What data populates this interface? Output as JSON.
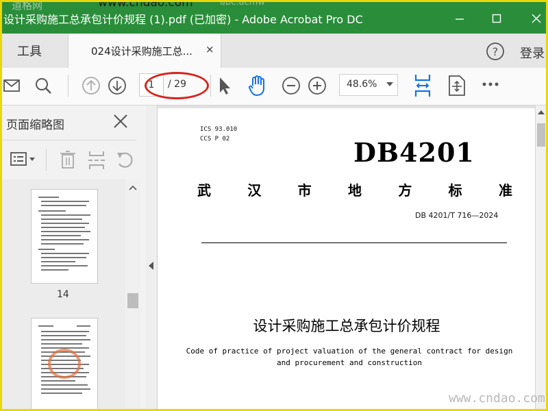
{
  "watermark": {
    "top_left": "道格网",
    "url_overlay": "www.cndao.com",
    "url_overlay2": "abc.acmw",
    "bottom_right": "www.cndao.com"
  },
  "window": {
    "title": "设计采购施工总承包计价规程 (1).pdf  (已加密)  - Adobe Acrobat Pro DC",
    "buttons": [
      "minimize-icon",
      "maximize-icon",
      "close-icon"
    ]
  },
  "tabbar": {
    "tools_label": "工具",
    "tab_label": "024设计采购施工总...",
    "tab_close": "×",
    "login_label": "登录"
  },
  "toolbar": {
    "icons": [
      "mail-icon",
      "search-icon",
      "prev-page-icon",
      "next-page-icon",
      "select-arrow-icon",
      "hand-icon",
      "zoom-out-icon",
      "zoom-in-icon",
      "fit-page-icon",
      "scroll-mode-icon",
      "more-icon"
    ],
    "page_current": "1",
    "page_total": "/ 29",
    "zoom": "48.6%"
  },
  "sidebar": {
    "title": "页面缩略图",
    "thumbnails": [
      {
        "label": "14"
      },
      {
        "label": ""
      }
    ]
  },
  "document": {
    "ics": "ICS  93.010",
    "ccs": "CCS P 02",
    "logo": "DB4201",
    "authority_chars": [
      "武",
      "汉",
      "市",
      "地",
      "方",
      "标",
      "准"
    ],
    "std_number": "DB 4201/T 716—2024",
    "title_cn": "设计采购施工总承包计价规程",
    "title_en_line1": "Code of practice of project valuation of the general contract for design",
    "title_en_line2": "and procurement and construction"
  },
  "colors": {
    "titlebar": "#2a8d3a",
    "accent_blue": "#1473e6",
    "highlight_red": "#d8231e",
    "frame_yellow": "#e8d80a"
  }
}
